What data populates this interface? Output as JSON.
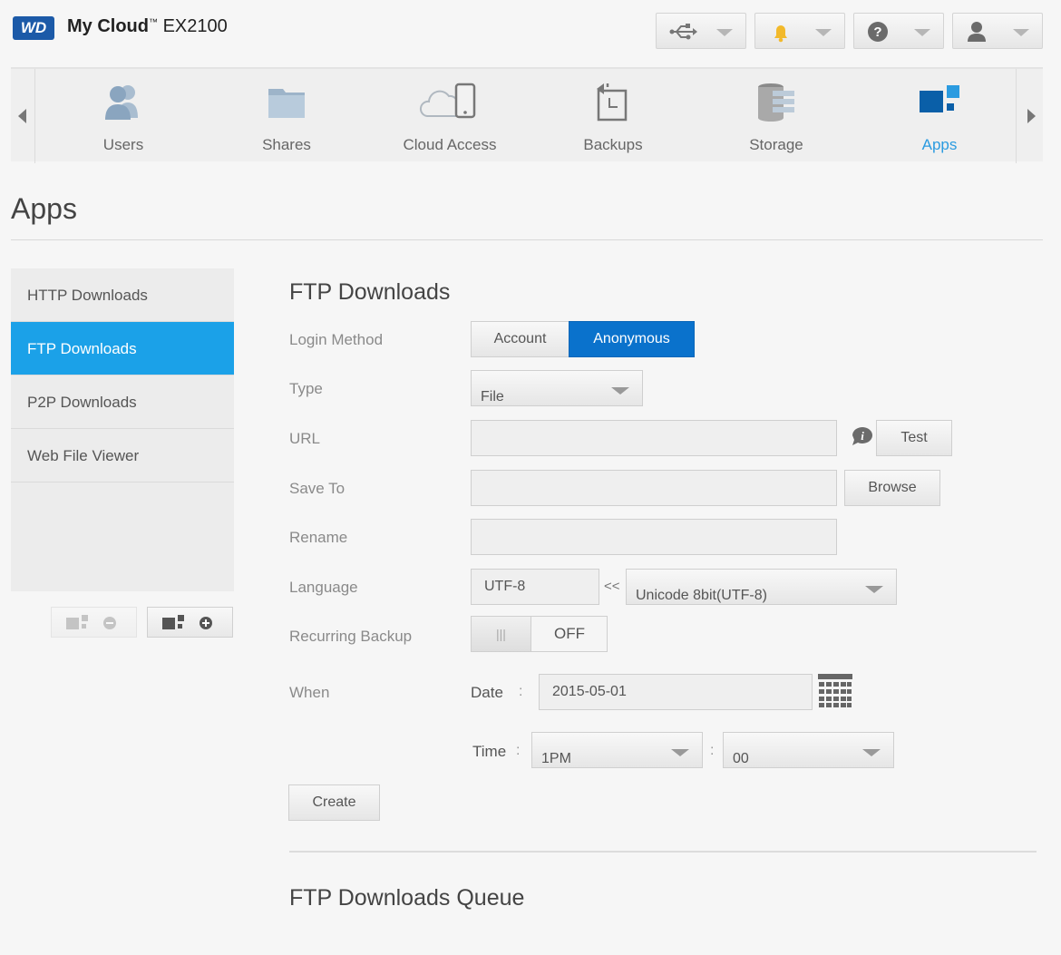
{
  "header": {
    "logo_text": "WD",
    "brand": "My Cloud",
    "trademark": "™",
    "model": "EX2100",
    "buttons": [
      {
        "icon": "usb-icon"
      },
      {
        "icon": "bell-icon",
        "color": "#f2b92b"
      },
      {
        "icon": "help-icon"
      },
      {
        "icon": "user-icon"
      }
    ]
  },
  "nav": {
    "items": [
      {
        "label": "Users",
        "icon": "users-icon"
      },
      {
        "label": "Shares",
        "icon": "folder-icon"
      },
      {
        "label": "Cloud Access",
        "icon": "cloud-device-icon"
      },
      {
        "label": "Backups",
        "icon": "backup-icon"
      },
      {
        "label": "Storage",
        "icon": "storage-icon"
      },
      {
        "label": "Apps",
        "icon": "apps-icon",
        "active": true
      }
    ],
    "active_color": "#2b9be0"
  },
  "page": {
    "title": "Apps"
  },
  "sidebar": {
    "items": [
      {
        "label": "HTTP Downloads"
      },
      {
        "label": "FTP Downloads",
        "active": true
      },
      {
        "label": "P2P Downloads"
      },
      {
        "label": "Web File Viewer"
      }
    ],
    "active_color": "#1ba1e8"
  },
  "form": {
    "title": "FTP Downloads",
    "login_method": {
      "label": "Login Method",
      "options": [
        "Account",
        "Anonymous"
      ],
      "selected": "Anonymous"
    },
    "type": {
      "label": "Type",
      "value": "File"
    },
    "url": {
      "label": "URL",
      "value": "",
      "test_button": "Test"
    },
    "save_to": {
      "label": "Save To",
      "value": "",
      "browse_button": "Browse"
    },
    "rename": {
      "label": "Rename",
      "value": ""
    },
    "language": {
      "label": "Language",
      "value": "UTF-8",
      "arrows": "<<",
      "select": "Unicode 8bit(UTF-8)"
    },
    "recurring": {
      "label": "Recurring Backup",
      "toggle_grip": "|||",
      "state": "OFF"
    },
    "when": {
      "label": "When",
      "date_label": "Date",
      "date_value": "2015-05-01",
      "time_label": "Time",
      "hour": "1PM",
      "minute": "00",
      "sep": ":"
    },
    "create_button": "Create"
  },
  "queue": {
    "title": "FTP Downloads Queue"
  }
}
